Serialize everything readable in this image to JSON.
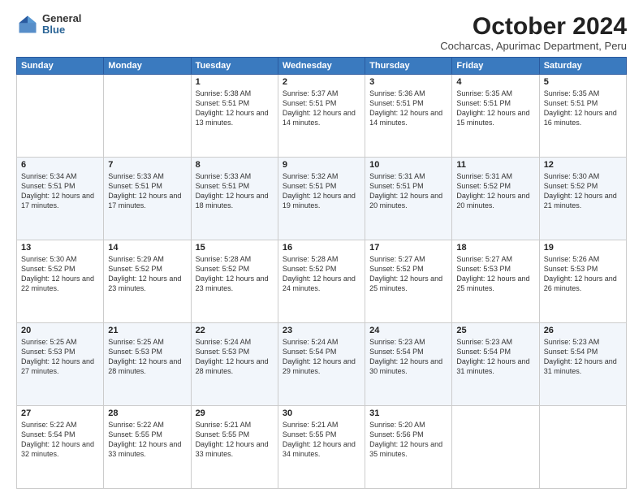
{
  "logo": {
    "general": "General",
    "blue": "Blue"
  },
  "title": "October 2024",
  "subtitle": "Cocharcas, Apurimac Department, Peru",
  "columns": [
    "Sunday",
    "Monday",
    "Tuesday",
    "Wednesday",
    "Thursday",
    "Friday",
    "Saturday"
  ],
  "weeks": [
    [
      {
        "day": "",
        "info": ""
      },
      {
        "day": "",
        "info": ""
      },
      {
        "day": "1",
        "info": "Sunrise: 5:38 AM\nSunset: 5:51 PM\nDaylight: 12 hours\nand 13 minutes."
      },
      {
        "day": "2",
        "info": "Sunrise: 5:37 AM\nSunset: 5:51 PM\nDaylight: 12 hours\nand 14 minutes."
      },
      {
        "day": "3",
        "info": "Sunrise: 5:36 AM\nSunset: 5:51 PM\nDaylight: 12 hours\nand 14 minutes."
      },
      {
        "day": "4",
        "info": "Sunrise: 5:35 AM\nSunset: 5:51 PM\nDaylight: 12 hours\nand 15 minutes."
      },
      {
        "day": "5",
        "info": "Sunrise: 5:35 AM\nSunset: 5:51 PM\nDaylight: 12 hours\nand 16 minutes."
      }
    ],
    [
      {
        "day": "6",
        "info": "Sunrise: 5:34 AM\nSunset: 5:51 PM\nDaylight: 12 hours\nand 17 minutes."
      },
      {
        "day": "7",
        "info": "Sunrise: 5:33 AM\nSunset: 5:51 PM\nDaylight: 12 hours\nand 17 minutes."
      },
      {
        "day": "8",
        "info": "Sunrise: 5:33 AM\nSunset: 5:51 PM\nDaylight: 12 hours\nand 18 minutes."
      },
      {
        "day": "9",
        "info": "Sunrise: 5:32 AM\nSunset: 5:51 PM\nDaylight: 12 hours\nand 19 minutes."
      },
      {
        "day": "10",
        "info": "Sunrise: 5:31 AM\nSunset: 5:51 PM\nDaylight: 12 hours\nand 20 minutes."
      },
      {
        "day": "11",
        "info": "Sunrise: 5:31 AM\nSunset: 5:52 PM\nDaylight: 12 hours\nand 20 minutes."
      },
      {
        "day": "12",
        "info": "Sunrise: 5:30 AM\nSunset: 5:52 PM\nDaylight: 12 hours\nand 21 minutes."
      }
    ],
    [
      {
        "day": "13",
        "info": "Sunrise: 5:30 AM\nSunset: 5:52 PM\nDaylight: 12 hours\nand 22 minutes."
      },
      {
        "day": "14",
        "info": "Sunrise: 5:29 AM\nSunset: 5:52 PM\nDaylight: 12 hours\nand 23 minutes."
      },
      {
        "day": "15",
        "info": "Sunrise: 5:28 AM\nSunset: 5:52 PM\nDaylight: 12 hours\nand 23 minutes."
      },
      {
        "day": "16",
        "info": "Sunrise: 5:28 AM\nSunset: 5:52 PM\nDaylight: 12 hours\nand 24 minutes."
      },
      {
        "day": "17",
        "info": "Sunrise: 5:27 AM\nSunset: 5:52 PM\nDaylight: 12 hours\nand 25 minutes."
      },
      {
        "day": "18",
        "info": "Sunrise: 5:27 AM\nSunset: 5:53 PM\nDaylight: 12 hours\nand 25 minutes."
      },
      {
        "day": "19",
        "info": "Sunrise: 5:26 AM\nSunset: 5:53 PM\nDaylight: 12 hours\nand 26 minutes."
      }
    ],
    [
      {
        "day": "20",
        "info": "Sunrise: 5:25 AM\nSunset: 5:53 PM\nDaylight: 12 hours\nand 27 minutes."
      },
      {
        "day": "21",
        "info": "Sunrise: 5:25 AM\nSunset: 5:53 PM\nDaylight: 12 hours\nand 28 minutes."
      },
      {
        "day": "22",
        "info": "Sunrise: 5:24 AM\nSunset: 5:53 PM\nDaylight: 12 hours\nand 28 minutes."
      },
      {
        "day": "23",
        "info": "Sunrise: 5:24 AM\nSunset: 5:54 PM\nDaylight: 12 hours\nand 29 minutes."
      },
      {
        "day": "24",
        "info": "Sunrise: 5:23 AM\nSunset: 5:54 PM\nDaylight: 12 hours\nand 30 minutes."
      },
      {
        "day": "25",
        "info": "Sunrise: 5:23 AM\nSunset: 5:54 PM\nDaylight: 12 hours\nand 31 minutes."
      },
      {
        "day": "26",
        "info": "Sunrise: 5:23 AM\nSunset: 5:54 PM\nDaylight: 12 hours\nand 31 minutes."
      }
    ],
    [
      {
        "day": "27",
        "info": "Sunrise: 5:22 AM\nSunset: 5:54 PM\nDaylight: 12 hours\nand 32 minutes."
      },
      {
        "day": "28",
        "info": "Sunrise: 5:22 AM\nSunset: 5:55 PM\nDaylight: 12 hours\nand 33 minutes."
      },
      {
        "day": "29",
        "info": "Sunrise: 5:21 AM\nSunset: 5:55 PM\nDaylight: 12 hours\nand 33 minutes."
      },
      {
        "day": "30",
        "info": "Sunrise: 5:21 AM\nSunset: 5:55 PM\nDaylight: 12 hours\nand 34 minutes."
      },
      {
        "day": "31",
        "info": "Sunrise: 5:20 AM\nSunset: 5:56 PM\nDaylight: 12 hours\nand 35 minutes."
      },
      {
        "day": "",
        "info": ""
      },
      {
        "day": "",
        "info": ""
      }
    ]
  ]
}
